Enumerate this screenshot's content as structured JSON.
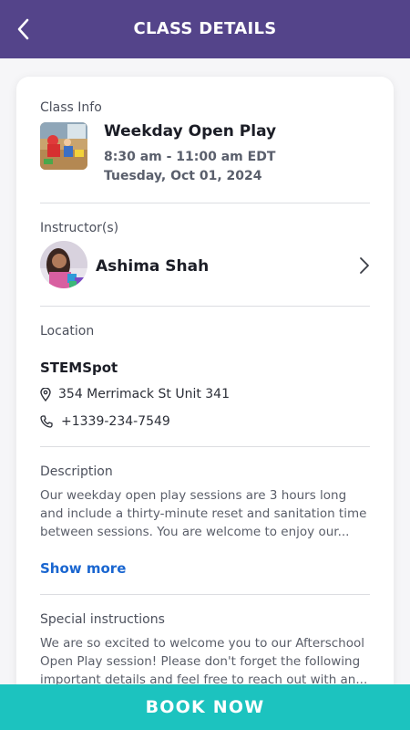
{
  "header": {
    "title": "CLASS DETAILS"
  },
  "class_info": {
    "section_label": "Class Info",
    "name": "Weekday Open Play",
    "time": "8:30 am - 11:00 am EDT",
    "date": "Tuesday, Oct 01, 2024"
  },
  "instructor": {
    "section_label": "Instructor(s)",
    "name": "Ashima Shah"
  },
  "location": {
    "section_label": "Location",
    "name": "STEMSpot",
    "address": "354 Merrimack St Unit 341",
    "phone": "+1339-234-7549"
  },
  "description": {
    "section_label": "Description",
    "lines": [
      "Our weekday open play sessions are 3 hours long",
      "and include a thirty-minute reset and sanitation time",
      "between sessions.  You are welcome to enjoy our..."
    ],
    "show_more": "Show more"
  },
  "special_instructions": {
    "section_label": "Special instructions",
    "lines": [
      "We are so excited to welcome you to our Afterschool",
      "Open Play session! Please don't forget the following",
      "important details and feel free to reach out with an..."
    ]
  },
  "footer": {
    "book_label": "BOOK NOW"
  },
  "colors": {
    "header": "#54448a",
    "accent_link": "#1a66d0",
    "book_button": "#1cc3bf"
  },
  "icons": [
    "back-arrow-icon",
    "chevron-right-icon",
    "location-pin-icon",
    "phone-icon"
  ]
}
